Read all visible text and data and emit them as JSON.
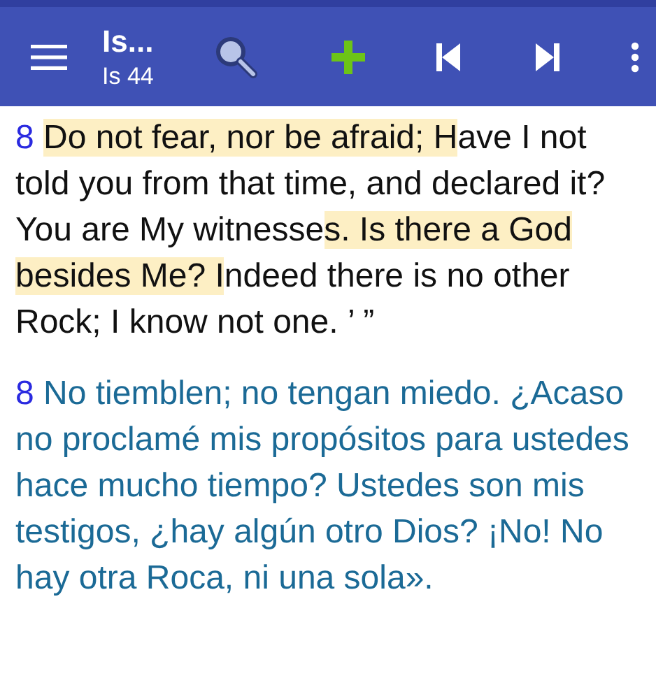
{
  "toolbar": {
    "title": "Is...",
    "subtitle": "Is 44"
  },
  "verses": [
    {
      "kind": "primary",
      "number": "8",
      "segments": [
        {
          "text": "Do not fear, nor be afraid; H",
          "highlighted": true
        },
        {
          "text": "ave I not told you from that time, and declared it? You are My witnesse",
          "highlighted": false
        },
        {
          "text": "s. Is there a God besides Me? I",
          "highlighted": true
        },
        {
          "text": "ndeed there is no other Rock; I know not one. ’ ”",
          "highlighted": false
        }
      ]
    },
    {
      "kind": "parallel",
      "number": "8",
      "segments": [
        {
          "text": "No tiemblen; no tengan miedo. ¿Acaso no proclamé mis propósitos para ustedes hace mucho tiempo? Ustedes son mis testigos, ¿hay algún otro Dios? ¡No! No hay otra Roca, ni una sola».",
          "highlighted": false
        }
      ]
    }
  ]
}
